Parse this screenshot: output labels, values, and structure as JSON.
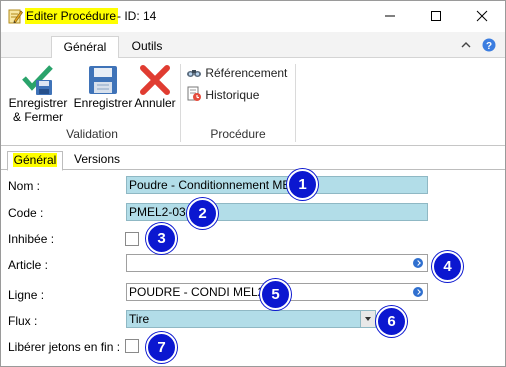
{
  "window": {
    "title_highlight": "Editer Procédure",
    "title_rest": "- ID: 14"
  },
  "ribbon": {
    "tabs": [
      "Général",
      "Outils"
    ],
    "buttons": {
      "save_close_line1": "Enregistrer",
      "save_close_line2": "& Fermer",
      "save": "Enregistrer",
      "cancel": "Annuler"
    },
    "links": {
      "referencing": "Référencement",
      "history": "Historique"
    },
    "groups": {
      "validation": "Validation",
      "procedure": "Procédure"
    }
  },
  "form_tabs": [
    "Général",
    "Versions"
  ],
  "form": {
    "nom_label": "Nom :",
    "nom_value": "Poudre - Conditionnement MEL2",
    "code_label": "Code :",
    "code_value": "PMEL2-03",
    "inhibee_label": "Inhibée :",
    "article_label": "Article :",
    "article_value": "",
    "ligne_label": "Ligne :",
    "ligne_value": "POUDRE - CONDI MEL2",
    "flux_label": "Flux :",
    "flux_value": "Tire",
    "liberer_label": "Libérer jetons en fin :"
  },
  "badges": [
    "1",
    "2",
    "3",
    "4",
    "5",
    "6",
    "7"
  ],
  "colors": {
    "title_highlight": "#ffff00",
    "required_field": "#b2dde8",
    "badge": "#0b17d0",
    "save_check": "#2aa36b",
    "cancel_x": "#e03c31",
    "floppy": "#3f73b8"
  }
}
